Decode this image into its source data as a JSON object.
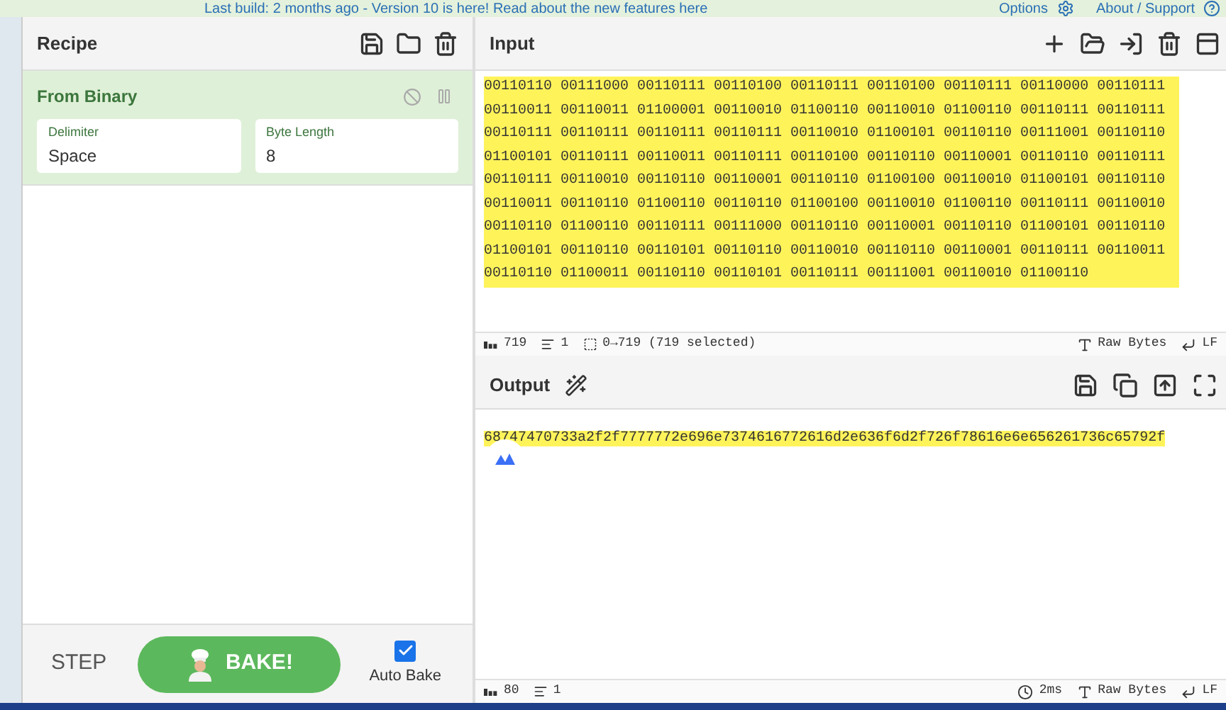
{
  "banner": {
    "text": "Last build: 2 months ago - Version 10 is here! Read about the new features here",
    "options": "Options",
    "about": "About / Support"
  },
  "recipe": {
    "title": "Recipe",
    "operations": [
      {
        "name": "From Binary",
        "disabled": false,
        "paused": false,
        "fields": [
          {
            "label": "Delimiter",
            "value": "Space"
          },
          {
            "label": "Byte Length",
            "value": "8"
          }
        ]
      }
    ]
  },
  "controls": {
    "step": "STEP",
    "bake": "BAKE!",
    "auto_bake": {
      "label": "Auto Bake",
      "checked": true
    }
  },
  "input": {
    "title": "Input",
    "text": "00110110 00111000 00110111 00110100 00110111 00110100 00110111 00110000 00110111 00110011 00110011 01100001 00110010 01100110 00110010 01100110 00110111 00110111 00110111 00110111 00110111 00110111 00110010 01100101 00110110 00111001 00110110 01100101 00110111 00110011 00110111 00110100 00110110 00110001 00110110 00110111 00110111 00110010 00110110 00110001 00110110 01100100 00110010 01100101 00110110 00110011 00110110 01100110 00110110 01100100 00110010 01100110 00110111 00110010 00110110 01100110 00110111 00111000 00110110 00110001 00110110 01100101 00110110 01100101 00110110 00110101 00110110 00110010 00110110 00110001 00110111 00110011 00110110 01100011 00110110 00110101 00110111 00111001 00110010 01100110",
    "selected": true,
    "status": {
      "length": "719",
      "lines": "1",
      "selection": "0→719 (719 selected)",
      "encoding": "Raw Bytes",
      "eol": "LF"
    }
  },
  "output": {
    "title": "Output",
    "text": "68747470733a2f2f7777772e696e7374616772616d2e636f6d2f726f78616e6e656261736c65792f",
    "selected": true,
    "status": {
      "length": "80",
      "lines": "1",
      "time": "2ms",
      "encoding": "Raw Bytes",
      "eol": "LF"
    }
  }
}
